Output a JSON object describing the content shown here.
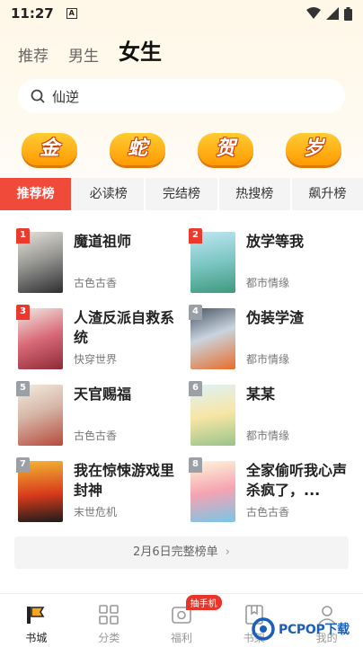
{
  "status": {
    "time": "11:27",
    "notification_icon": "A"
  },
  "top_tabs": [
    {
      "label": "推荐",
      "active": false
    },
    {
      "label": "男生",
      "active": false
    },
    {
      "label": "女生",
      "active": true
    }
  ],
  "search": {
    "value": "仙逆"
  },
  "banner": [
    "金",
    "蛇",
    "贺",
    "岁"
  ],
  "rank_tabs": [
    {
      "label": "推荐榜",
      "active": true
    },
    {
      "label": "必读榜",
      "active": false
    },
    {
      "label": "完结榜",
      "active": false
    },
    {
      "label": "热搜榜",
      "active": false
    },
    {
      "label": "飙升榜",
      "active": false
    }
  ],
  "books": [
    {
      "rank": "1",
      "title": "魔道祖师",
      "genre": "古色古香"
    },
    {
      "rank": "2",
      "title": "放学等我",
      "genre": "都市情缘"
    },
    {
      "rank": "3",
      "title": "人渣反派自救系统",
      "genre": "快穿世界"
    },
    {
      "rank": "4",
      "title": "伪装学渣",
      "genre": "都市情缘"
    },
    {
      "rank": "5",
      "title": "天官赐福",
      "genre": "古色古香"
    },
    {
      "rank": "6",
      "title": "某某",
      "genre": "都市情缘"
    },
    {
      "rank": "7",
      "title": "我在惊悚游戏里封神",
      "genre": "末世危机"
    },
    {
      "rank": "8",
      "title": "全家偷听我心声杀疯了，...",
      "genre": "古色古香"
    }
  ],
  "full_list_label": "2月6日完整榜单",
  "bottom_nav": [
    {
      "label": "书城",
      "active": true
    },
    {
      "label": "分类",
      "active": false
    },
    {
      "label": "福利",
      "active": false,
      "badge": "抽手机"
    },
    {
      "label": "书架",
      "active": false
    },
    {
      "label": "我的",
      "active": false
    }
  ],
  "watermark": "PCPOP下载",
  "colors": {
    "accent_red": "#f04a3b",
    "badge_red": "#ea3a2e",
    "banner_orange": "#ff9a00"
  }
}
